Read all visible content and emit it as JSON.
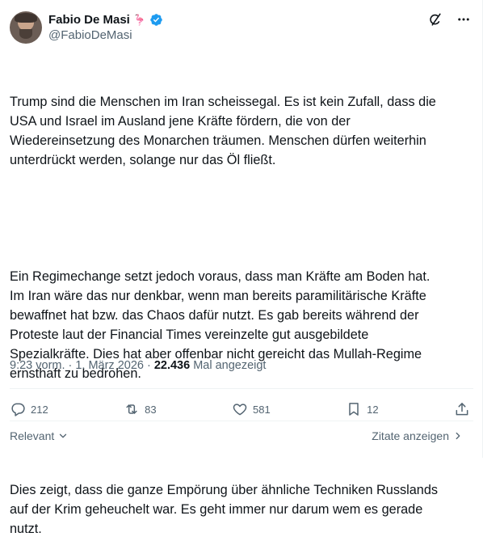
{
  "author": {
    "name": "Fabio De Masi",
    "emoji": "🦩",
    "handle": "@FabioDeMasi"
  },
  "tweet": {
    "paragraphs": [
      "Trump sind die Menschen im Iran scheissegal. Es ist kein Zufall, dass die\nUSA und Israel im Ausland jene Kräfte fördern, die von der\nWiedereinsetzung des Monarchen träumen. Menschen dürfen weiterhin\nunterdrückt werden, solange nur das Öl fließt.",
      "Ein Regimechange setzt jedoch voraus, dass man Kräfte am Boden hat.\nIm Iran wäre das nur denkbar, wenn man bereits paramilitärische Kräfte\nbewaffnet hat bzw. das Chaos dafür nutzt. Es gab bereits während der\nProteste laut der Financial Times vereinzelte gut ausgebildete\nSpezialkräfte. Dies hat aber offenbar nicht gereicht das Mullah-Regime\nernsthaft zu bedrohen.",
      "Dies zeigt, dass die ganze Empörung über ähnliche Techniken Russlands\nauf der Krim geheuchelt war. Es geht immer nur darum wem es gerade\nnutzt."
    ]
  },
  "meta": {
    "time": "9:23 vorm.",
    "dot1": "·",
    "date": "1. März 2026",
    "dot2": "·",
    "views": "22.436",
    "views_label": "Mal angezeigt"
  },
  "actions": {
    "replies": "212",
    "reposts": "83",
    "likes": "581",
    "bookmarks": "12"
  },
  "footer": {
    "sort_label": "Relevant",
    "quotes_label": "Zitate anzeigen"
  },
  "colors": {
    "text": "#0f1419",
    "secondary": "#536471",
    "verified": "#1d9bf0",
    "border": "#eff3f4"
  }
}
